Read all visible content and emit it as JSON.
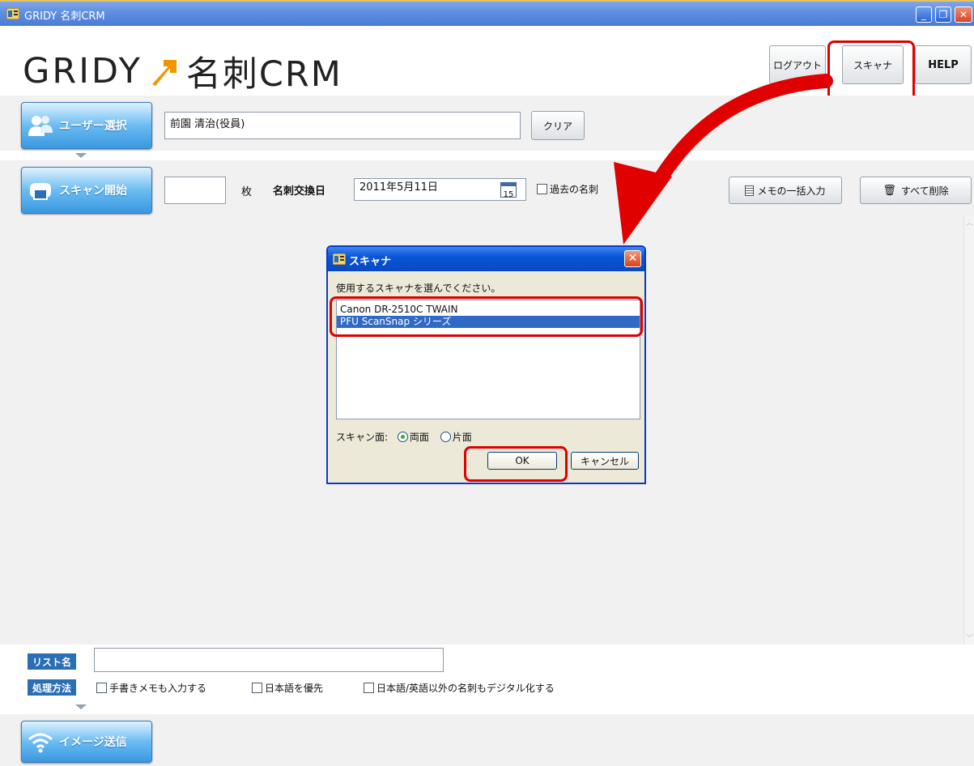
{
  "window": {
    "title": "GRIDY 名刺CRM",
    "minimize": "_",
    "restore": "❐",
    "close": "✕"
  },
  "header": {
    "logo_gridy": "GRIDY",
    "logo_crm": "名刺CRM",
    "logout_label": "ログアウト",
    "scanner_label": "スキャナ",
    "help_label": "HELP"
  },
  "user_bar": {
    "select_user_label": "ユーザー選択",
    "user_value": "前園 清治(役員)",
    "clear_label": "クリア"
  },
  "scan_bar": {
    "start_scan_label": "スキャン開始",
    "count_value": "",
    "count_unit": "枚",
    "exchange_date_label": "名刺交換日",
    "exchange_date_value": "2011年5月11日",
    "calendar_day": "15",
    "past_cards_label": "過去の名刺",
    "bulk_memo_label": "メモの一括入力",
    "delete_all_label": "すべて削除"
  },
  "dialog": {
    "title": "スキャナ",
    "prompt": "使用するスキャナを選んでください。",
    "scanners": [
      {
        "name": "Canon DR-2510C TWAIN",
        "selected": false
      },
      {
        "name": "PFU ScanSnap シリーズ",
        "selected": true
      }
    ],
    "scan_side_label": "スキャン面:",
    "duplex_label": "両面",
    "simplex_label": "片面",
    "duplex_selected": true,
    "ok_label": "OK",
    "cancel_label": "キャンセル"
  },
  "bottom": {
    "list_name_label": "リスト名",
    "list_name_value": "",
    "method_label": "処理方法",
    "option_handwritten": "手書きメモも入力する",
    "option_japanese_priority": "日本語を優先",
    "option_other_languages": "日本語/英語以外の名刺もデジタル化する",
    "send_image_label": "イメージ送信"
  },
  "colors": {
    "accent_blue": "#3a98df",
    "highlight_red": "#e00000",
    "logo_orange": "#f29600",
    "selection_blue": "#316ac5"
  }
}
